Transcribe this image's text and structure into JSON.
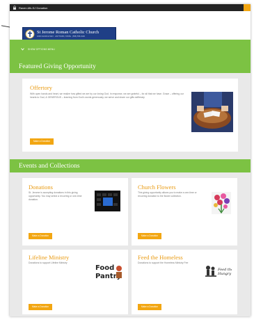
{
  "topbar": {
    "title": "Raven-Mk-SJ Donation"
  },
  "logo": {
    "name": "St Jerome Roman Catholic Church",
    "address": "1000 CHURCH WAY · ANYTOWN, STATE · (555) 555-0100"
  },
  "nav": {
    "toggle_label": "SHOW OPTIONS MENU"
  },
  "featured": {
    "heading": "Featured Giving Opportunity",
    "card": {
      "title": "Offertory",
      "description": "With open hands and heart, we realize how gifted we are by our loving God. In response, we are grateful – for all that we have. Grace – offering our hearts to God, & GENEROUS – learning from God's words generously, we serve and share our gifts selflessly.",
      "button": "Make a Donation"
    }
  },
  "events": {
    "heading": "Events and Collections",
    "cards": [
      {
        "title": "Donations",
        "description": "St. Jerome is accepting donations in this giving opportunity. You may select a recurring or one-time donation.",
        "button": "Make a Donation"
      },
      {
        "title": "Church Flowers",
        "description": "This giving opportunity allows you to make a one-time or recurring donation to the flower collection.",
        "button": "Make a Donation"
      },
      {
        "title": "Lifeline Ministry",
        "description": "Donations to support Lifeline Ministry",
        "button": "Make a Donation",
        "image_text": "Food Pantry"
      },
      {
        "title": "Feed the Homeless",
        "description": "Donations to support the Homeless Ministry Fee",
        "button": "Make a Donation",
        "image_text": "Feed the Hungry"
      }
    ]
  },
  "colors": {
    "green": "#7cc243",
    "orange": "#f2a612",
    "navy": "#1f3f86",
    "title_orange": "#e99a10"
  },
  "icons": [
    "lock-icon",
    "chevron-down-icon",
    "church-crest-icon"
  ]
}
